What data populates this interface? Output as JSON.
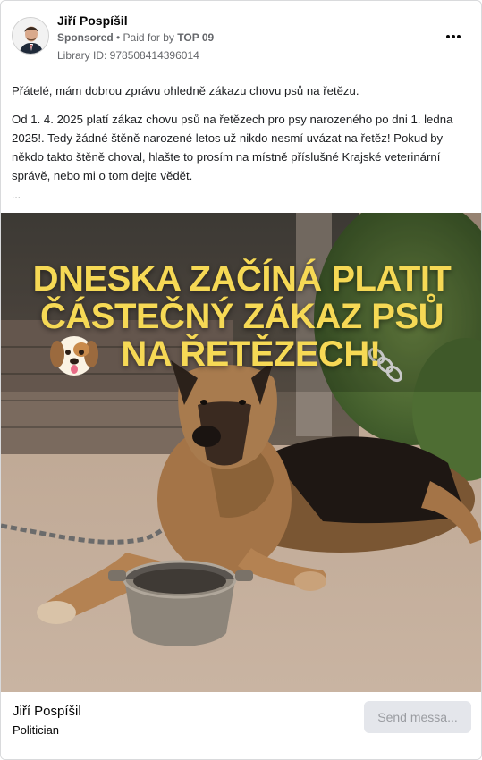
{
  "header": {
    "author": "Jiří Pospíšil",
    "sponsored": "Sponsored",
    "paid_for_prefix": " • Paid for by ",
    "paid_for_by": "TOP 09",
    "library_id": "Library ID: 978508414396014",
    "more_icon": "more-horizontal-icon"
  },
  "post": {
    "paragraph1": "Přátelé, mám dobrou zprávu ohledně zákazu chovu psů na řetězu.",
    "paragraph2": "Od 1. 4. 2025 platí zákaz chovu psů na řetězech pro psy narozeného po dni 1. ledna 2025!. Tedy žádné štěně narozené letos už nikdo nesmí uvázat na řetěz! Pokud by někdo takto štěně choval, hlašte to prosím na místně příslušné Krajské veterinární správě, nebo mi o tom dejte vědět.",
    "ellipsis": "..."
  },
  "image": {
    "headline_line1": "DNESKA ZAČÍNÁ PLATIT",
    "headline_line2": "ČÁSTEČNÝ ZÁKAZ PSŮ",
    "headline_line3": "NA ŘETĚZECH!",
    "headline_color": "#f6d955",
    "emoji_icon": "dog-face-icon",
    "chain_icon": "chain-icon"
  },
  "footer": {
    "name": "Jiří Pospíšil",
    "category": "Politician",
    "send_button": "Send messa..."
  }
}
